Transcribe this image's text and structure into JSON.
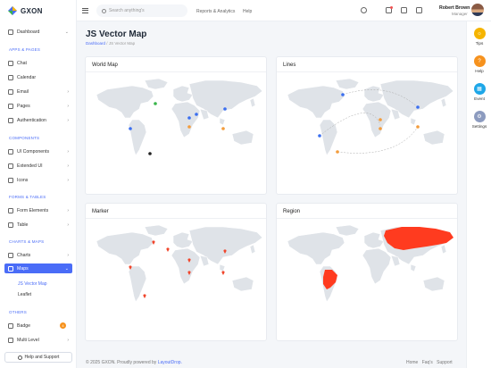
{
  "app": {
    "name": "GXON"
  },
  "sidebar": {
    "sections": {
      "apps_pages": "APPS & PAGES",
      "components": "COMPONENTS",
      "forms_tables": "FORMS & TABLES",
      "charts_maps": "CHARTS & MAPS",
      "others": "OTHERS"
    },
    "items": {
      "dashboard": "Dashboard",
      "chat": "Chat",
      "calendar": "Calendar",
      "email": "Email",
      "pages": "Pages",
      "authentication": "Authentication",
      "ui_components": "UI Components",
      "extended_ui": "Extended UI",
      "icons": "Icons",
      "form_elements": "Form Elements",
      "table": "Table",
      "charts": "Charts",
      "maps": "Maps",
      "badge": "Badge",
      "multi_level": "Multi Level"
    },
    "subitems": {
      "js_vector_map": "JS Vector Map",
      "leaflet": "Leaflet"
    },
    "badge_count": "4",
    "help_button": "Help and Support"
  },
  "topbar": {
    "search_placeholder": "Search anything's",
    "links": {
      "reports": "Reports & Analytics",
      "help": "Help"
    },
    "user": {
      "name": "Robert Brown",
      "role": "Manager"
    }
  },
  "rail": {
    "tips": "Tips",
    "help": "Help",
    "event": "Event",
    "settings": "Settings",
    "colors": {
      "tips": "#f5b400",
      "help": "#f6921e",
      "event": "#1ea7e8",
      "settings": "#8c9bbf"
    }
  },
  "page": {
    "title": "JS Vector Map",
    "breadcrumb": {
      "home": "Dashboard",
      "sep": "/",
      "current": "JS Vector Map"
    }
  },
  "cards": {
    "world_map": "World Map",
    "lines": "Lines",
    "marker": "Marker",
    "region": "Region"
  },
  "colors": {
    "accent": "#4a6cf7",
    "land": "#dfe3e8",
    "region_highlight": "#ff3b1f",
    "marker_blue": "#3b6ff0",
    "marker_orange": "#f39c3c",
    "marker_green": "#39b54a",
    "marker_dark": "#222222"
  },
  "footer": {
    "copyright": "© 2025 GXON. Proudly powered by",
    "powered_by": "LayoutDrop.",
    "links": "Home  Faq's  Support"
  }
}
